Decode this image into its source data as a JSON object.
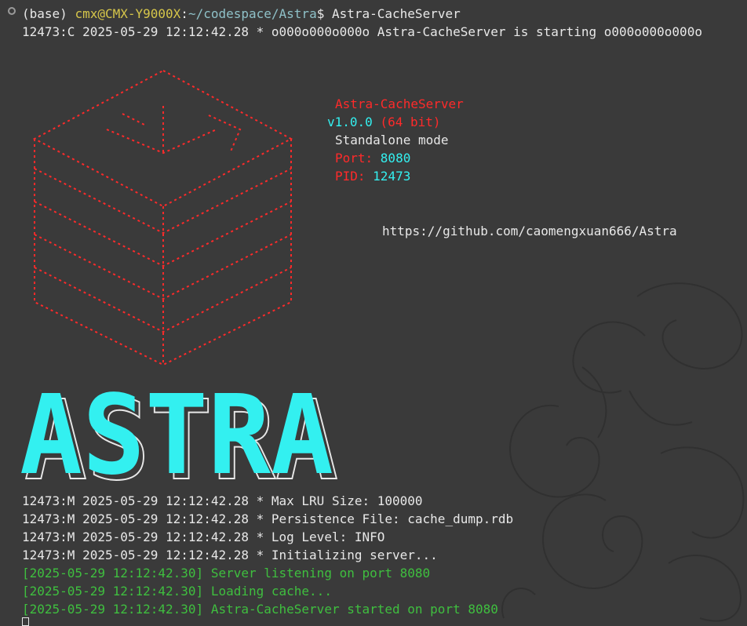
{
  "command_line": {
    "env": "(base) ",
    "user_host": "cmx@CMX-Y9000X",
    "sep": ":",
    "path": "~/codespace/Astra",
    "dollar": "$ ",
    "command": "Astra-CacheServer"
  },
  "start_line": "12473:C 2025-05-29 12:12:42.28 * o000o000o000o Astra-CacheServer is starting o000o000o000o",
  "info": {
    "name": "Astra-CacheServer",
    "version": "v1.0.0",
    "bits": " (64 bit)",
    "mode": "Standalone mode",
    "port_label": "Port: ",
    "port_value": "8080",
    "pid_label": "PID: ",
    "pid_value": "12473",
    "url": "https://github.com/caomengxuan666/Astra"
  },
  "banner_text": "ASTRA",
  "log_lines": [
    "12473:M 2025-05-29 12:12:42.28 * Max LRU Size: 100000",
    "12473:M 2025-05-29 12:12:42.28 * Persistence File: cache_dump.rdb",
    "12473:M 2025-05-29 12:12:42.28 * Log Level: INFO",
    "12473:M 2025-05-29 12:12:42.28 * Initializing server..."
  ],
  "status_lines": [
    "[2025-05-29 12:12:42.30] Server listening on port 8080",
    "[2025-05-29 12:12:42.30] Loading cache...",
    "[2025-05-29 12:12:42.30] Astra-CacheServer started on port 8080"
  ],
  "colors": {
    "background": "#3a3a3a",
    "logo_red": "#ff2a2a",
    "banner_cyan": "#33f0f0",
    "status_green": "#3fbf3f"
  }
}
